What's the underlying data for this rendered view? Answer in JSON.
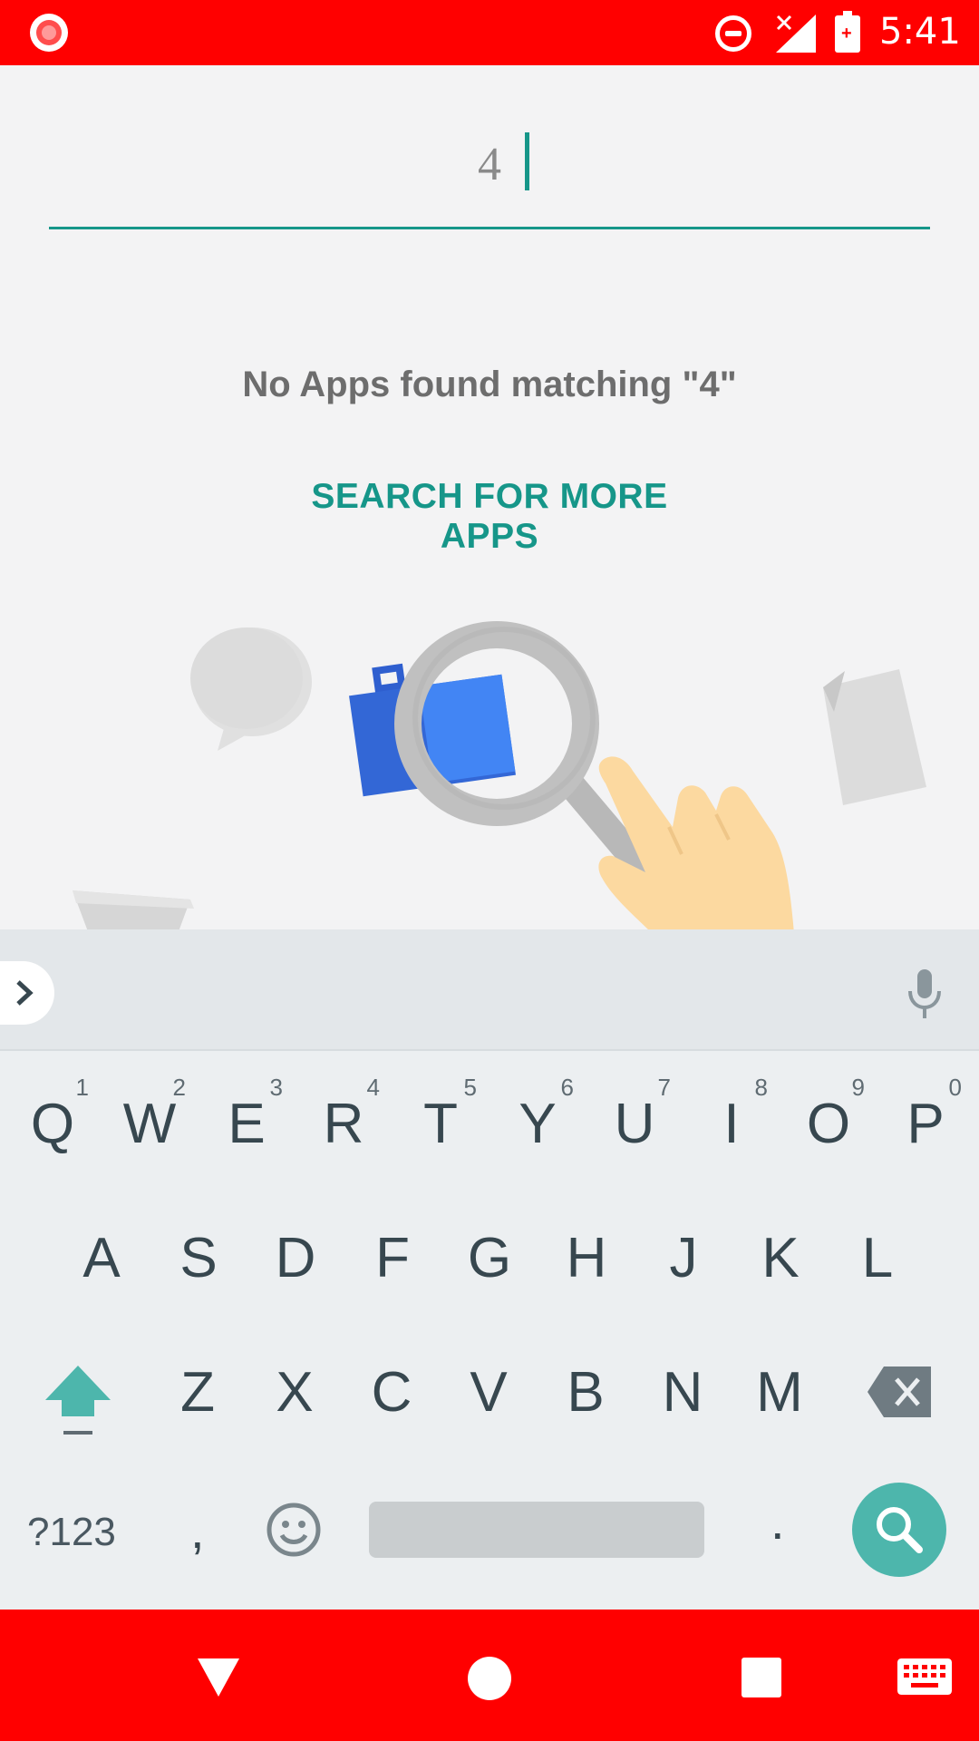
{
  "status_bar": {
    "time": "5:41",
    "icons": [
      "screen-record-icon",
      "do-not-disturb-icon",
      "signal-no-data-icon",
      "battery-charging-icon"
    ]
  },
  "search": {
    "query": "4"
  },
  "results": {
    "empty_message": "No Apps found matching \"4\"",
    "more_apps_label": "SEARCH FOR MORE APPS"
  },
  "keyboard": {
    "row1": [
      {
        "key": "Q",
        "hint": "1"
      },
      {
        "key": "W",
        "hint": "2"
      },
      {
        "key": "E",
        "hint": "3"
      },
      {
        "key": "R",
        "hint": "4"
      },
      {
        "key": "T",
        "hint": "5"
      },
      {
        "key": "Y",
        "hint": "6"
      },
      {
        "key": "U",
        "hint": "7"
      },
      {
        "key": "I",
        "hint": "8"
      },
      {
        "key": "O",
        "hint": "9"
      },
      {
        "key": "P",
        "hint": "0"
      }
    ],
    "row2": [
      "A",
      "S",
      "D",
      "F",
      "G",
      "H",
      "J",
      "K",
      "L"
    ],
    "row3": [
      "Z",
      "X",
      "C",
      "V",
      "B",
      "N",
      "M"
    ],
    "symbols_label": "?123",
    "comma_label": ",",
    "period_label": ".",
    "accent_color": "#4db6ac"
  },
  "colors": {
    "status_bar": "#ff0000",
    "accent": "#169689"
  }
}
